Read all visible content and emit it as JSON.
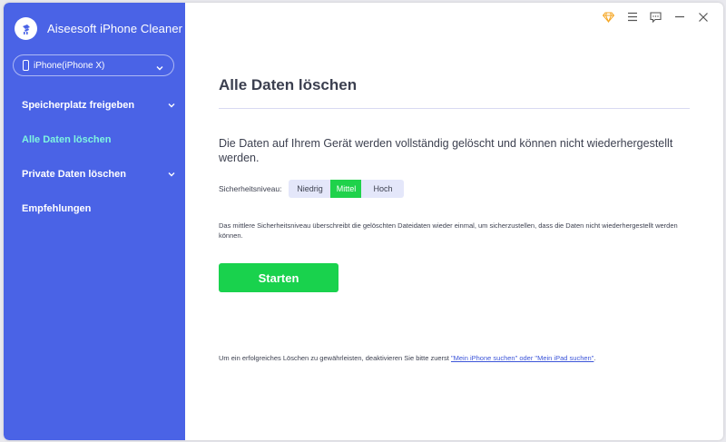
{
  "app": {
    "name": "Aiseesoft iPhone Cleaner"
  },
  "device": {
    "label": "iPhone(iPhone X)"
  },
  "sidebar": {
    "items": [
      {
        "label": "Speicherplatz freigeben",
        "has_submenu": true,
        "active": false
      },
      {
        "label": "Alle Daten löschen",
        "has_submenu": false,
        "active": true
      },
      {
        "label": "Private Daten löschen",
        "has_submenu": true,
        "active": false
      },
      {
        "label": "Empfehlungen",
        "has_submenu": false,
        "active": false
      }
    ]
  },
  "topbar": {
    "icons": [
      "diamond-icon",
      "menu-icon",
      "feedback-icon",
      "minimize-icon",
      "close-icon"
    ]
  },
  "main": {
    "title": "Alle Daten löschen",
    "description": "Die Daten auf Ihrem Gerät werden vollständig gelöscht und können nicht wiederhergestellt werden.",
    "security_label": "Sicherheitsniveau:",
    "levels": [
      "Niedrig",
      "Mittel",
      "Hoch"
    ],
    "selected_level": "Mittel",
    "note": "Das mittlere Sicherheitsniveau überschreibt die gelöschten Dateidaten wieder einmal, um sicherzustellen, dass die Daten nicht wiederhergestellt werden können.",
    "start_button": "Starten",
    "footer_text": "Um ein erfolgreiches Löschen zu gewährleisten, deaktivieren Sie bitte zuerst ",
    "footer_link": "\"Mein iPhone suchen\" oder \"Mein iPad suchen\"",
    "footer_end": "."
  },
  "colors": {
    "sidebar": "#4a63e6",
    "active_nav": "#7ef5e1",
    "accent_green": "#19d24d",
    "diamond": "#f5a623",
    "link": "#3c55d9"
  }
}
